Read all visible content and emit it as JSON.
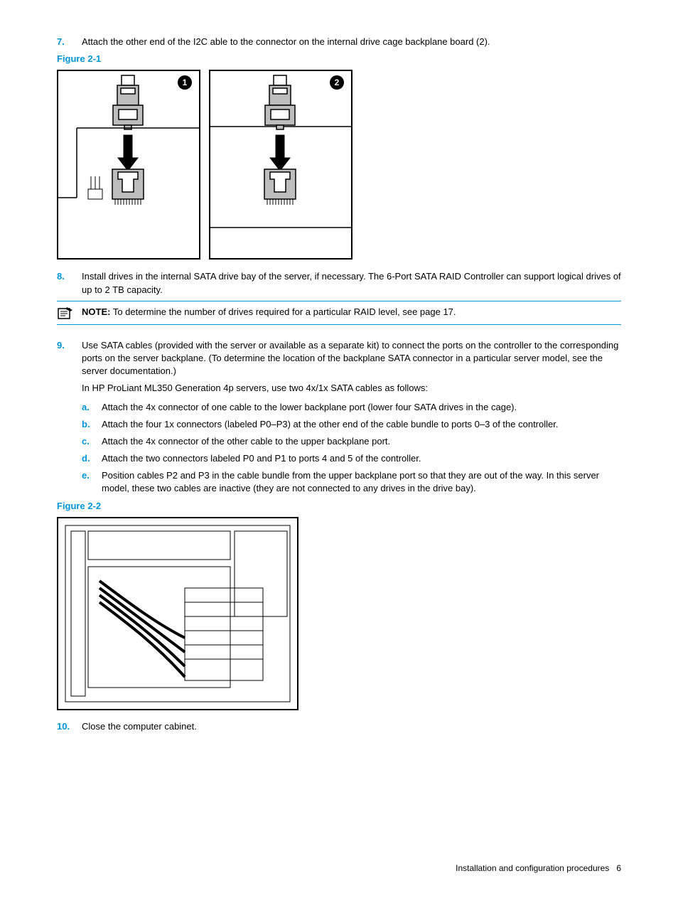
{
  "steps": {
    "s7_num": "7.",
    "s7_text": "Attach the other end of the I2C able to the connector on the internal drive cage backplane board (2).",
    "fig21_label": "Figure 2-1",
    "callout1": "1",
    "callout2": "2",
    "s8_num": "8.",
    "s8_text": "Install drives in the internal SATA drive bay of the server, if necessary. The 6-Port SATA RAID Controller can support logical drives of up to 2 TB capacity.",
    "note_label": "NOTE:",
    "note_text": " To determine the number of drives required for a particular RAID level, see page 17.",
    "s9_num": "9.",
    "s9_text": "Use SATA cables (provided with the server or available as a separate kit) to connect the ports on the controller to the corresponding ports on the server backplane. (To determine the location of the backplane SATA connector in a particular server model, see the server documentation.)",
    "s9_para2": "In HP ProLiant ML350 Generation 4p servers, use two 4x/1x SATA cables as follows:",
    "sub": {
      "a_num": "a.",
      "a_text": "Attach the 4x connector of one cable to the lower backplane port (lower four SATA drives in the cage).",
      "b_num": "b.",
      "b_text": "Attach the four 1x connectors (labeled P0–P3) at the other end of the cable bundle to ports 0–3 of the controller.",
      "c_num": "c.",
      "c_text": "Attach the 4x connector of the other cable to the upper backplane port.",
      "d_num": "d.",
      "d_text": "Attach the two connectors labeled P0 and P1 to ports 4 and 5 of the controller.",
      "e_num": "e.",
      "e_text": "Position cables P2 and P3 in the cable bundle from the upper backplane port so that they are out of the way. In this server model, these two cables are inactive (they are not connected to any drives in the drive bay)."
    },
    "fig22_label": "Figure 2-2",
    "s10_num": "10.",
    "s10_text": "Close the computer cabinet."
  },
  "footer": {
    "section": "Installation and configuration procedures",
    "page": "6"
  }
}
